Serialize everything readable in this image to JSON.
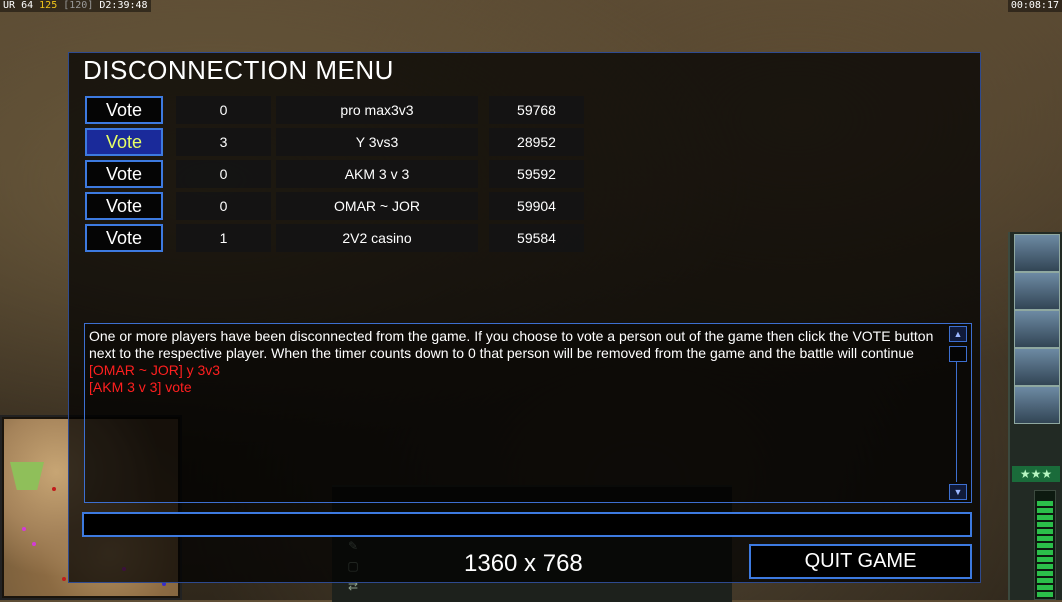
{
  "hud": {
    "left_prefix": "UR",
    "left_a": "64",
    "left_b": "125",
    "left_c": "[120]",
    "left_time": "D2:39:48",
    "right_time": "00:08:17"
  },
  "dialog": {
    "title": "DISCONNECTION MENU",
    "players": [
      {
        "vote_label": "Vote",
        "votes": "0",
        "name": "pro max3v3",
        "ping": "59768",
        "active": false
      },
      {
        "vote_label": "Vote",
        "votes": "3",
        "name": "Y 3vs3",
        "ping": "28952",
        "active": true
      },
      {
        "vote_label": "Vote",
        "votes": "0",
        "name": "AKM 3 v 3",
        "ping": "59592",
        "active": false
      },
      {
        "vote_label": "Vote",
        "votes": "0",
        "name": "OMAR ~ JOR",
        "ping": "59904",
        "active": false
      },
      {
        "vote_label": "Vote",
        "votes": "1",
        "name": "2V2 casino",
        "ping": "59584",
        "active": false
      }
    ],
    "message": "One or more players have been disconnected from the game. If you choose to vote a person out of the game then click the VOTE button next to the respective player. When the timer counts down to 0 that person will be removed from the game and the battle will continue",
    "chat_lines": [
      "[OMAR ~ JOR] y 3v3",
      "[AKM 3 v 3] vote"
    ],
    "chat_value": "",
    "resolution": "1360 x 768",
    "quit_label": "QUIT GAME"
  },
  "colors": {
    "accent_blue": "#3d7ae0",
    "chat_red": "#ff1f1f",
    "active_vote_text": "#e6ff66"
  },
  "side": {
    "stars": "★★★"
  }
}
